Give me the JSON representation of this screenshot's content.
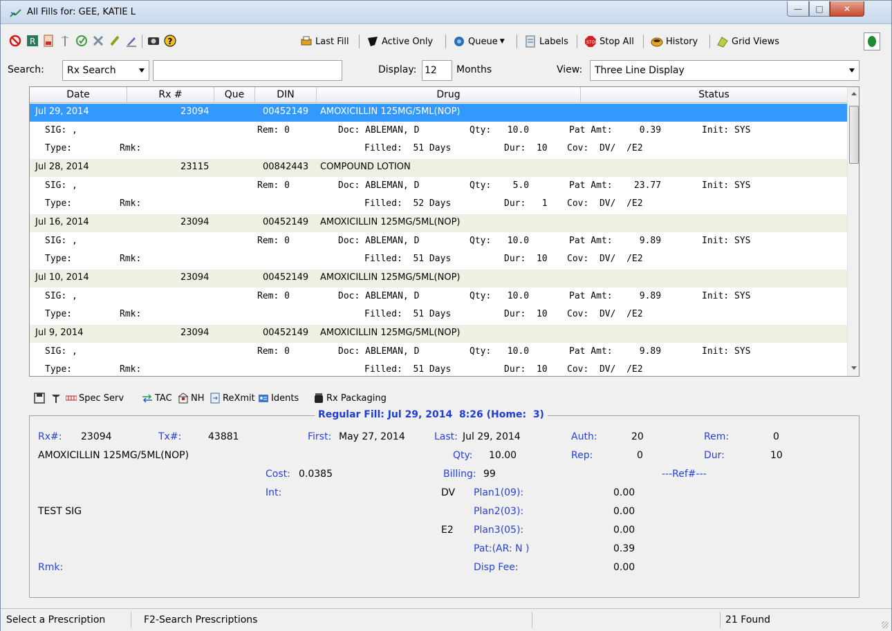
{
  "window": {
    "title": "All Fills for: GEE, KATIE L"
  },
  "toolbar": {
    "buttons": [
      {
        "label": "Last Fill",
        "icon": "printer-icon"
      },
      {
        "label": "Active Only",
        "icon": "filter-icon"
      },
      {
        "label": "Queue",
        "icon": "queue-icon"
      },
      {
        "label": "Labels",
        "icon": "labels-icon"
      },
      {
        "label": "Stop All",
        "icon": "stop-icon"
      },
      {
        "label": "History",
        "icon": "history-icon"
      },
      {
        "label": "Grid Views",
        "icon": "grid-views-icon"
      }
    ]
  },
  "search": {
    "label": "Search:",
    "mode": "Rx Search",
    "value": "",
    "display_label": "Display:",
    "display_value": "12",
    "months_label": "Months",
    "view_label": "View:",
    "view_value": "Three Line Display"
  },
  "grid": {
    "columns": [
      "Date",
      "Rx #",
      "Que",
      "DIN",
      "Drug",
      "Status"
    ],
    "rows": [
      {
        "date": "Jul 29, 2014",
        "rx": "23094",
        "din": "00452149",
        "drug": "AMOXICILLIN 125MG/5ML(NOP)",
        "line2": "SIG: ,",
        "rem": "Rem: 0",
        "doc": "Doc: ABLEMAN, D",
        "qty": "Qty:   10.0",
        "pat": "Pat Amt:     0.39",
        "init": "Init: SYS",
        "type": "Type:",
        "rmk": "Rmk:",
        "filled": "Filled:  51 Days",
        "dur": "Dur:  10",
        "cov": "Cov:  DV/  /E2"
      },
      {
        "date": "Jul 28, 2014",
        "rx": "23115",
        "din": "00842443",
        "drug": "COMPOUND LOTION",
        "line2": "SIG: ,",
        "rem": "Rem: 0",
        "doc": "Doc: ABLEMAN, D",
        "qty": "Qty:    5.0",
        "pat": "Pat Amt:    23.77",
        "init": "Init: SYS",
        "type": "Type:",
        "rmk": "Rmk:",
        "filled": "Filled:  52 Days",
        "dur": "Dur:   1",
        "cov": "Cov:  DV/  /E2"
      },
      {
        "date": "Jul 16, 2014",
        "rx": "23094",
        "din": "00452149",
        "drug": "AMOXICILLIN 125MG/5ML(NOP)",
        "line2": "SIG: ,",
        "rem": "Rem: 0",
        "doc": "Doc: ABLEMAN, D",
        "qty": "Qty:   10.0",
        "pat": "Pat Amt:     9.89",
        "init": "Init: SYS",
        "type": "Type:",
        "rmk": "Rmk:",
        "filled": "Filled:  51 Days",
        "dur": "Dur:  10",
        "cov": "Cov:  DV/  /E2"
      },
      {
        "date": "Jul 10, 2014",
        "rx": "23094",
        "din": "00452149",
        "drug": "AMOXICILLIN 125MG/5ML(NOP)",
        "line2": "SIG: ,",
        "rem": "Rem: 0",
        "doc": "Doc: ABLEMAN, D",
        "qty": "Qty:   10.0",
        "pat": "Pat Amt:     9.89",
        "init": "Init: SYS",
        "type": "Type:",
        "rmk": "Rmk:",
        "filled": "Filled:  51 Days",
        "dur": "Dur:  10",
        "cov": "Cov:  DV/  /E2"
      },
      {
        "date": "Jul 9, 2014",
        "rx": "23094",
        "din": "00452149",
        "drug": "AMOXICILLIN 125MG/5ML(NOP)",
        "line2": "SIG: ,",
        "rem": "Rem: 0",
        "doc": "Doc: ABLEMAN, D",
        "qty": "Qty:   10.0",
        "pat": "Pat Amt:     9.89",
        "init": "Init: SYS",
        "type": "Type:",
        "rmk": "Rmk:",
        "filled": "Filled:  51 Days",
        "dur": "Dur:  10",
        "cov": "Cov:  DV/  /E2"
      }
    ]
  },
  "bottom_toolbar": {
    "spec_serv": "Spec Serv",
    "tac": "TAC",
    "nh": "NH",
    "rexmit": "ReXmit",
    "idents": "Idents",
    "rx_packaging": "Rx Packaging"
  },
  "detail": {
    "title": "Regular Fill: Jul 29, 2014  8:26 (Home:  3)",
    "rx_label": "Rx#:",
    "rx_value": "23094",
    "tx_label": "Tx#:",
    "tx_value": "43881",
    "first_label": "First:",
    "first_value": "May 27, 2014",
    "last_label": "Last:",
    "last_value": "Jul 29, 2014",
    "auth_label": "Auth:",
    "auth_value": "20",
    "rem_label": "Rem:",
    "rem_value": "0",
    "drug": "AMOXICILLIN 125MG/5ML(NOP)",
    "qty_label": "Qty:",
    "qty_value": "10.00",
    "rep_label": "Rep:",
    "rep_value": "0",
    "dur_label": "Dur:",
    "dur_value": "10",
    "cost_label": "Cost:",
    "cost_value": "0.0385",
    "billing_label": "Billing:",
    "billing_value": "99",
    "ref_label": "---Ref#---",
    "int_label": "Int:",
    "dv": "DV",
    "plan1_label": "Plan1(09):",
    "plan1_value": "0.00",
    "sig": "TEST SIG",
    "plan2_label": "Plan2(03):",
    "plan2_value": "0.00",
    "e2": "E2",
    "plan3_label": "Plan3(05):",
    "plan3_value": "0.00",
    "pat_label": "Pat:(AR: N )",
    "pat_value": "0.39",
    "rmk_label": "Rmk:",
    "disp_label": "Disp Fee:",
    "disp_value": "0.00"
  },
  "status": {
    "left": "Select a Prescription",
    "hint": "F2-Search Prescriptions",
    "found": "21 Found"
  },
  "colors": {
    "selection": "#3399ff",
    "row_band": "#f0efe4",
    "label_blue": "#2540e0"
  }
}
